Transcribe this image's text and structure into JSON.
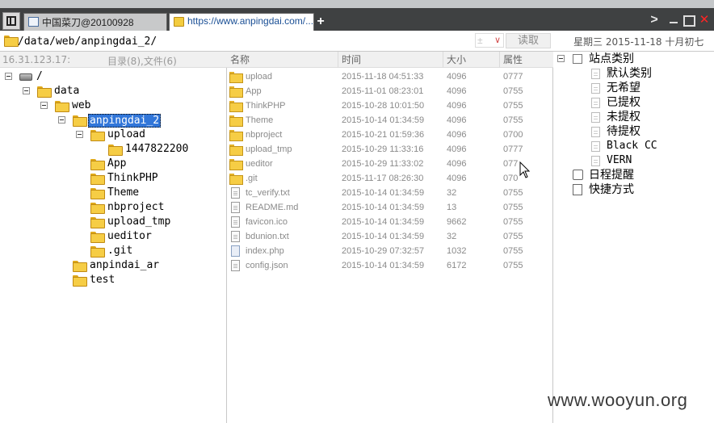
{
  "tabs": [
    {
      "label": "中国菜刀@20100928"
    },
    {
      "label": "https://www.anpingdai.com/..."
    }
  ],
  "new_tab_symbol": "+",
  "window": {
    "arrow_symbol": ">",
    "close_symbol": "✕"
  },
  "address": {
    "path": "/data/web/anpingdai_2/",
    "dropdown_value": "±",
    "read_button": "读取",
    "date": "星期三 2015-11-18 十月初七"
  },
  "left": {
    "host_ip": "16.31.123.17:",
    "counts": "目录(8),文件(6)",
    "tree": [
      {
        "label": "/"
      },
      {
        "label": "data"
      },
      {
        "label": "web"
      },
      {
        "label": "anpingdai_2"
      },
      {
        "label": "upload"
      },
      {
        "label": "1447822200"
      },
      {
        "label": "App"
      },
      {
        "label": "ThinkPHP"
      },
      {
        "label": "Theme"
      },
      {
        "label": "nbproject"
      },
      {
        "label": "upload_tmp"
      },
      {
        "label": "ueditor"
      },
      {
        "label": ".git"
      },
      {
        "label": "anpindai_ar"
      },
      {
        "label": "test"
      }
    ]
  },
  "files": {
    "columns": {
      "name": "名称",
      "time": "时间",
      "size": "大小",
      "attr": "属性"
    },
    "rows": [
      {
        "name": "upload",
        "time": "2015-11-18 04:51:33",
        "size": "4096",
        "attr": "0777",
        "type": "folder"
      },
      {
        "name": "App",
        "time": "2015-11-01 08:23:01",
        "size": "4096",
        "attr": "0755",
        "type": "folder"
      },
      {
        "name": "ThinkPHP",
        "time": "2015-10-28 10:01:50",
        "size": "4096",
        "attr": "0755",
        "type": "folder"
      },
      {
        "name": "Theme",
        "time": "2015-10-14 01:34:59",
        "size": "4096",
        "attr": "0755",
        "type": "folder"
      },
      {
        "name": "nbproject",
        "time": "2015-10-21 01:59:36",
        "size": "4096",
        "attr": "0700",
        "type": "folder"
      },
      {
        "name": "upload_tmp",
        "time": "2015-10-29 11:33:16",
        "size": "4096",
        "attr": "0777",
        "type": "folder"
      },
      {
        "name": "ueditor",
        "time": "2015-10-29 11:33:02",
        "size": "4096",
        "attr": "077",
        "type": "folder"
      },
      {
        "name": ".git",
        "time": "2015-11-17 08:26:30",
        "size": "4096",
        "attr": "070",
        "type": "folder"
      },
      {
        "name": "tc_verify.txt",
        "time": "2015-10-14 01:34:59",
        "size": "32",
        "attr": "0755",
        "type": "file"
      },
      {
        "name": "README.md",
        "time": "2015-10-14 01:34:59",
        "size": "13",
        "attr": "0755",
        "type": "file"
      },
      {
        "name": "favicon.ico",
        "time": "2015-10-14 01:34:59",
        "size": "9662",
        "attr": "0755",
        "type": "file"
      },
      {
        "name": "bdunion.txt",
        "time": "2015-10-14 01:34:59",
        "size": "32",
        "attr": "0755",
        "type": "file"
      },
      {
        "name": "index.php",
        "time": "2015-10-29 07:32:57",
        "size": "1032",
        "attr": "0755",
        "type": "php"
      },
      {
        "name": "config.json",
        "time": "2015-10-14 01:34:59",
        "size": "6172",
        "attr": "0755",
        "type": "file"
      }
    ]
  },
  "right": {
    "root": "站点类别",
    "categories": [
      "默认类别",
      "无希望",
      "已提权",
      "未提权",
      "待提权",
      "Black CC",
      "VERN"
    ],
    "schedule": "日程提醒",
    "shortcuts": "快捷方式"
  },
  "watermark": "www.wooyun.org",
  "colors": {
    "tabbar": "#3f4142",
    "selection": "#3176d9",
    "folder": "#f6cd45",
    "close": "#ff2424"
  }
}
